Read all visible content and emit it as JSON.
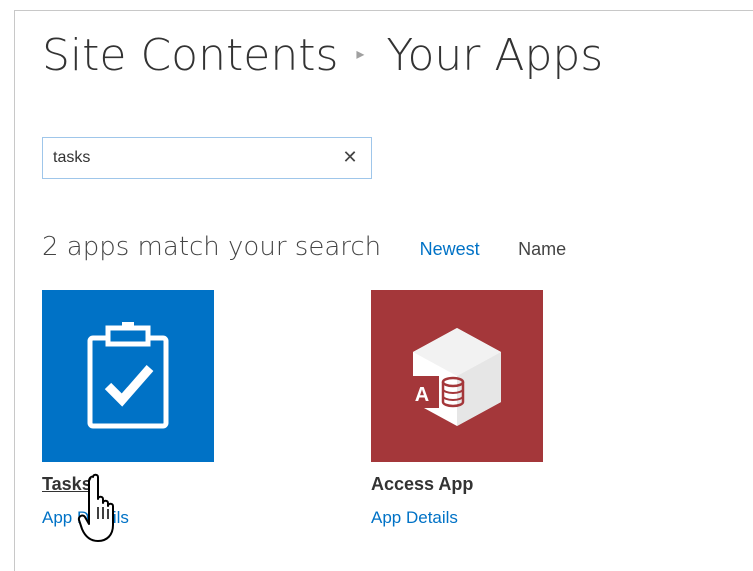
{
  "header": {
    "breadcrumb_root": "Site Contents",
    "breadcrumb_current": "Your Apps"
  },
  "search": {
    "value": "tasks",
    "clear_glyph": "✕"
  },
  "results": {
    "count_text": "2 apps match your search",
    "sort_options": [
      "Newest",
      "Name"
    ],
    "selected_sort": "Newest"
  },
  "apps": [
    {
      "name": "Tasks",
      "details_label": "App Details",
      "icon": "clipboard-check-icon",
      "tile_color": "#0072c6"
    },
    {
      "name": "Access App",
      "details_label": "App Details",
      "icon": "access-app-icon",
      "tile_color": "#a4373a"
    }
  ],
  "colors": {
    "link": "#0072c6",
    "text": "#333333"
  },
  "cursor": "hand-pointer"
}
